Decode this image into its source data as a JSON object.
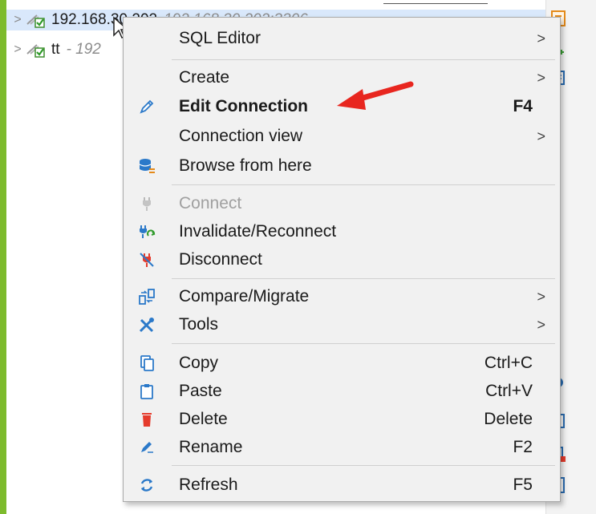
{
  "tree": {
    "rows": [
      {
        "label": "192.168.30.202",
        "desc": "192.168.30.202:3306"
      },
      {
        "label": "tt",
        "desc": "- 192"
      }
    ]
  },
  "menu": {
    "items": [
      {
        "id": "sql-editor",
        "label": "SQL Editor",
        "shortcut": "",
        "submenu": true,
        "icon": "none"
      },
      {
        "id": "create",
        "label": "Create",
        "shortcut": "",
        "submenu": true,
        "icon": "none"
      },
      {
        "id": "edit-connection",
        "label": "Edit Connection",
        "shortcut": "F4",
        "submenu": false,
        "icon": "pencil-icon"
      },
      {
        "id": "connection-view",
        "label": "Connection view",
        "shortcut": "",
        "submenu": true,
        "icon": "none"
      },
      {
        "id": "browse-from-here",
        "label": "Browse from here",
        "shortcut": "",
        "submenu": false,
        "icon": "database-icon"
      },
      {
        "id": "connect",
        "label": "Connect",
        "shortcut": "",
        "submenu": false,
        "icon": "plug-icon"
      },
      {
        "id": "invalidate-reconnect",
        "label": "Invalidate/Reconnect",
        "shortcut": "",
        "submenu": false,
        "icon": "reconnect-icon"
      },
      {
        "id": "disconnect",
        "label": "Disconnect",
        "shortcut": "",
        "submenu": false,
        "icon": "disconnect-icon"
      },
      {
        "id": "compare-migrate",
        "label": "Compare/Migrate",
        "shortcut": "",
        "submenu": true,
        "icon": "compare-icon"
      },
      {
        "id": "tools",
        "label": "Tools",
        "shortcut": "",
        "submenu": true,
        "icon": "tools-icon"
      },
      {
        "id": "copy",
        "label": "Copy",
        "shortcut": "Ctrl+C",
        "submenu": false,
        "icon": "copy-icon"
      },
      {
        "id": "paste",
        "label": "Paste",
        "shortcut": "Ctrl+V",
        "submenu": false,
        "icon": "paste-icon"
      },
      {
        "id": "delete",
        "label": "Delete",
        "shortcut": "Delete",
        "submenu": false,
        "icon": "trash-icon"
      },
      {
        "id": "rename",
        "label": "Rename",
        "shortcut": "F2",
        "submenu": false,
        "icon": "rename-icon"
      },
      {
        "id": "refresh",
        "label": "Refresh",
        "shortcut": "F5",
        "submenu": false,
        "icon": "refresh-icon"
      }
    ],
    "submenu_glyph": ">"
  },
  "colors": {
    "accent_stripe": "#7dbb2d",
    "annotation_arrow": "#e8261f",
    "selection": "#d9e8fb"
  }
}
